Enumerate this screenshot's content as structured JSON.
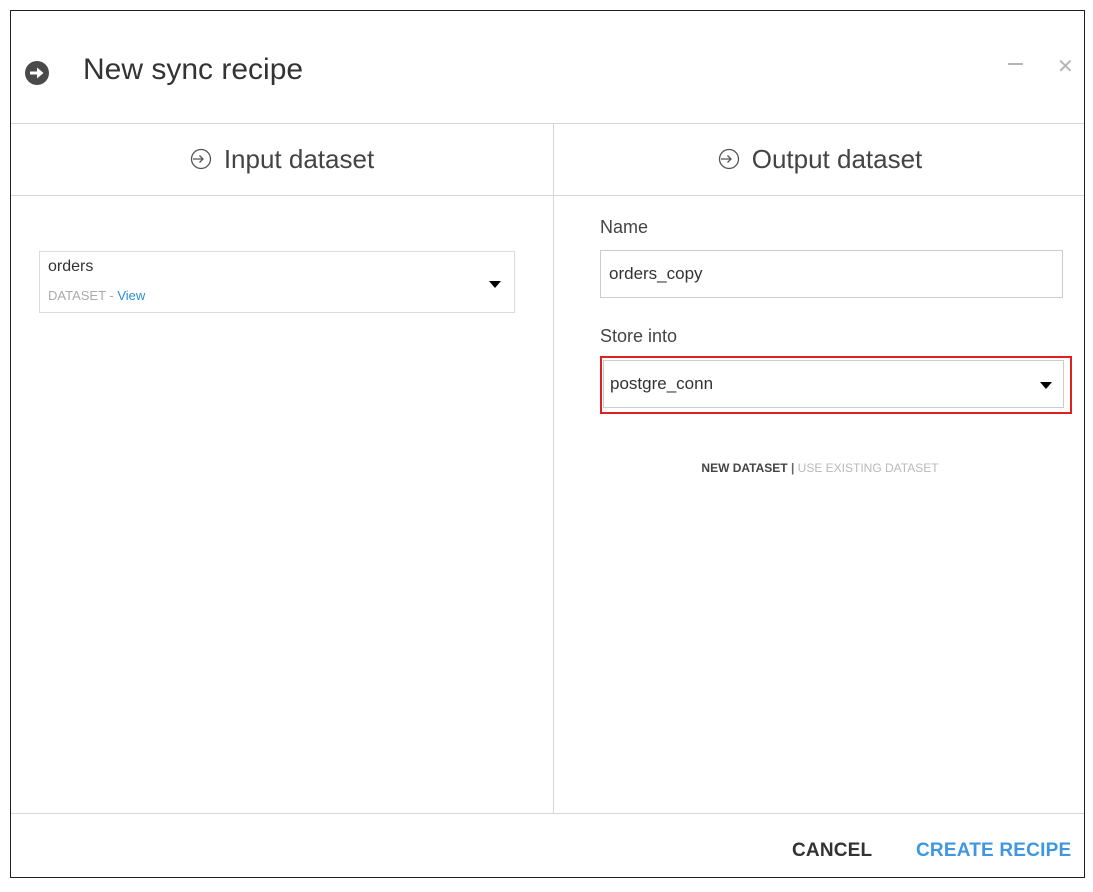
{
  "window": {
    "title": "New sync recipe"
  },
  "columns": {
    "input_title": "Input dataset",
    "output_title": "Output dataset"
  },
  "input": {
    "dataset_name": "orders",
    "dataset_type": "DATASET",
    "separator": " - ",
    "view_link": "View"
  },
  "output": {
    "name_label": "Name",
    "name_value": "orders_copy",
    "store_label": "Store into",
    "store_value": "postgre_conn",
    "new_dataset_label": "NEW DATASET",
    "toggle_separator": " | ",
    "use_existing_label": "USE EXISTING DATASET"
  },
  "footer": {
    "cancel_label": "CANCEL",
    "create_label": "CREATE RECIPE"
  },
  "icons": {
    "header": "circle-arrow-right-icon",
    "column": "enter-arrow-icon",
    "dropdown": "caret-down-icon"
  },
  "colors": {
    "accent": "#3f97e0",
    "highlight": "#e02020",
    "link": "#2b8fd6"
  }
}
